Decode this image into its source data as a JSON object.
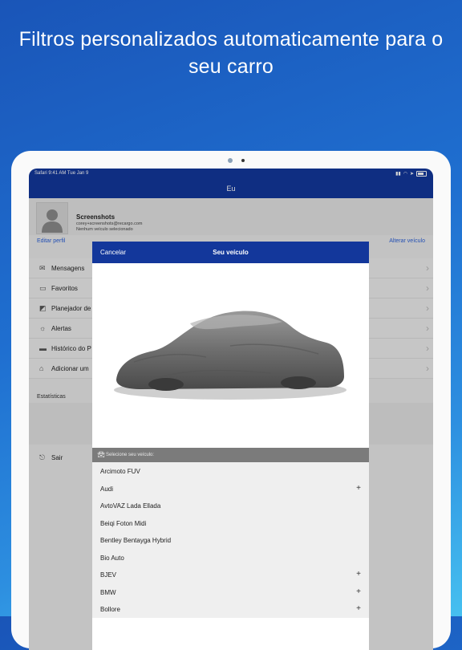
{
  "headline": "Filtros personalizados automaticamente para o seu carro",
  "status": {
    "left": "Safari  9:41 AM  Tue Jan 9"
  },
  "nav": {
    "title": "Eu"
  },
  "profile": {
    "name": "Screenshots",
    "email": "corey+screenshots@recargo.com",
    "vehicle": "Nenhum veículo selecionado",
    "edit_link": "Editar perfil",
    "change_vehicle_link": "Alterar veículo"
  },
  "menu": [
    {
      "label": "Mensagens",
      "icon": "envelope-icon"
    },
    {
      "label": "Favoritos",
      "icon": "book-icon"
    },
    {
      "label": "Planejador de",
      "icon": "map-icon"
    },
    {
      "label": "Alertas",
      "icon": "alarm-icon"
    },
    {
      "label": "Histórico do P",
      "icon": "card-icon"
    },
    {
      "label": "Adicionar um",
      "icon": "home-icon"
    }
  ],
  "stats_label": "Estatísticas",
  "logout_label": "Sair",
  "modal": {
    "cancel": "Cancelar",
    "title": "Seu veículo",
    "section_title": "Selecione seu veículo:",
    "vehicles": [
      {
        "label": "Arcimoto FUV",
        "expandable": false
      },
      {
        "label": "Audi",
        "expandable": true
      },
      {
        "label": "AvtoVAZ Lada Ellada",
        "expandable": false
      },
      {
        "label": "Beiqi Foton Midi",
        "expandable": false
      },
      {
        "label": "Bentley Bentayga Hybrid",
        "expandable": false
      },
      {
        "label": "Bio Auto",
        "expandable": false
      },
      {
        "label": "BJEV",
        "expandable": true
      },
      {
        "label": "BMW",
        "expandable": true
      },
      {
        "label": "Bollore",
        "expandable": true
      }
    ]
  },
  "colors": {
    "navbar": "#13379b",
    "link": "#2a5fd6",
    "section": "#7b7b7b"
  }
}
